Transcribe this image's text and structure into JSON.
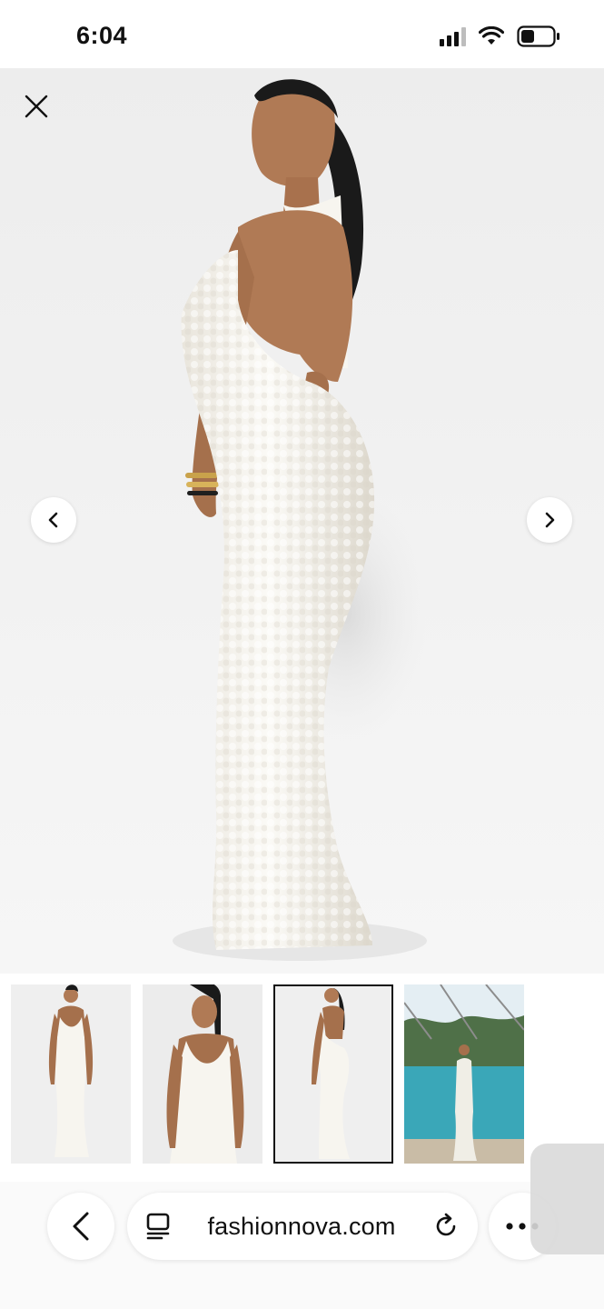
{
  "status_bar": {
    "time": "6:04",
    "icons": [
      "cellular-signal-icon",
      "wifi-icon",
      "battery-icon"
    ]
  },
  "viewer": {
    "image_alt": "Model wearing white sequin halter maxi dress, back view",
    "icons": {
      "close": "close-icon",
      "prev": "chevron-left-icon",
      "next": "chevron-right-icon"
    }
  },
  "thumbnails": {
    "selected_index": 2,
    "items": [
      {
        "alt": "Front view of white sequin gown"
      },
      {
        "alt": "Close front view of cowl neck"
      },
      {
        "alt": "Back view of white sequin gown"
      },
      {
        "alt": "Model by a pool wearing the gown"
      }
    ]
  },
  "browser": {
    "url": "fashionnova.com",
    "icons": {
      "back": "chevron-left-icon",
      "page": "page-menu-icon",
      "reload": "reload-icon",
      "more": "more-icon"
    }
  },
  "colors": {
    "background": "#f1f1f1",
    "dress": "#f7f5ef",
    "skin": "#b07a55",
    "hair": "#1a1a1a",
    "accent": "#111111"
  }
}
